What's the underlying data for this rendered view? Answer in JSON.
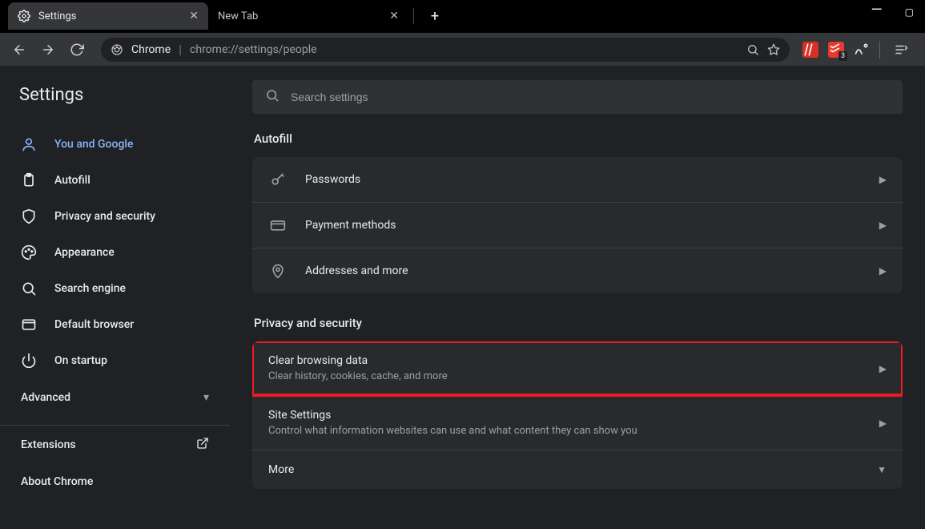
{
  "window": {
    "tabs": [
      {
        "title": "Settings",
        "active": true
      },
      {
        "title": "New Tab",
        "active": false
      }
    ]
  },
  "omnibox": {
    "product": "Chrome",
    "url": "chrome://settings/people"
  },
  "ext_badge": "3",
  "sidebar": {
    "title": "Settings",
    "items": [
      {
        "label": "You and Google"
      },
      {
        "label": "Autofill"
      },
      {
        "label": "Privacy and security"
      },
      {
        "label": "Appearance"
      },
      {
        "label": "Search engine"
      },
      {
        "label": "Default browser"
      },
      {
        "label": "On startup"
      }
    ],
    "advanced": "Advanced",
    "extensions": "Extensions",
    "about": "About Chrome"
  },
  "search": {
    "placeholder": "Search settings"
  },
  "sections": {
    "autofill": {
      "title": "Autofill",
      "rows": [
        {
          "title": "Passwords"
        },
        {
          "title": "Payment methods"
        },
        {
          "title": "Addresses and more"
        }
      ]
    },
    "privacy": {
      "title": "Privacy and security",
      "rows": [
        {
          "title": "Clear browsing data",
          "sub": "Clear history, cookies, cache, and more"
        },
        {
          "title": "Site Settings",
          "sub": "Control what information websites can use and what content they can show you"
        },
        {
          "title": "More"
        }
      ]
    }
  }
}
